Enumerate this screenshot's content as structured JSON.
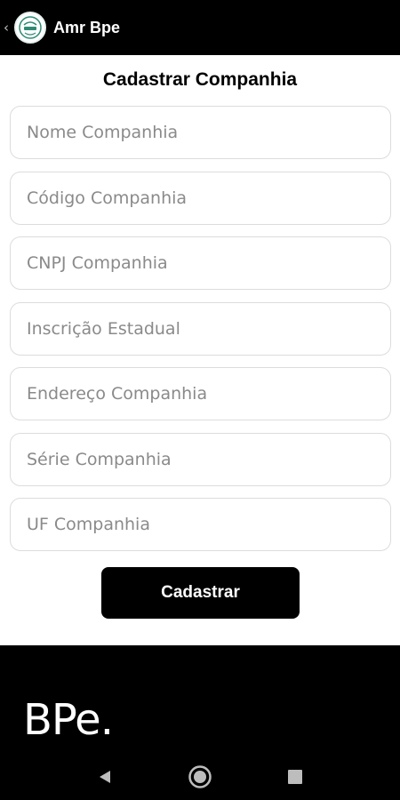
{
  "appbar": {
    "back_glyph": "‹",
    "title": "Amr Bpe",
    "logo_icon": "brand-logo-icon"
  },
  "form": {
    "title": "Cadastrar Companhia",
    "fields": [
      {
        "placeholder": "Nome Companhia",
        "value": ""
      },
      {
        "placeholder": "Código Companhia",
        "value": ""
      },
      {
        "placeholder": "CNPJ Companhia",
        "value": ""
      },
      {
        "placeholder": "Inscrição Estadual",
        "value": ""
      },
      {
        "placeholder": "Endereço Companhia",
        "value": ""
      },
      {
        "placeholder": "Série Companhia",
        "value": ""
      },
      {
        "placeholder": "UF Companhia",
        "value": ""
      }
    ],
    "submit_label": "Cadastrar"
  },
  "footer": {
    "brand": "BPe."
  },
  "navigation": {
    "icons": [
      "back-triangle-icon",
      "home-circle-icon",
      "recents-square-icon"
    ]
  },
  "colors": {
    "bar": "#000000",
    "field_border": "#dcdcdc",
    "placeholder": "#8a8a8a",
    "logo_accent": "#2e8b74"
  }
}
